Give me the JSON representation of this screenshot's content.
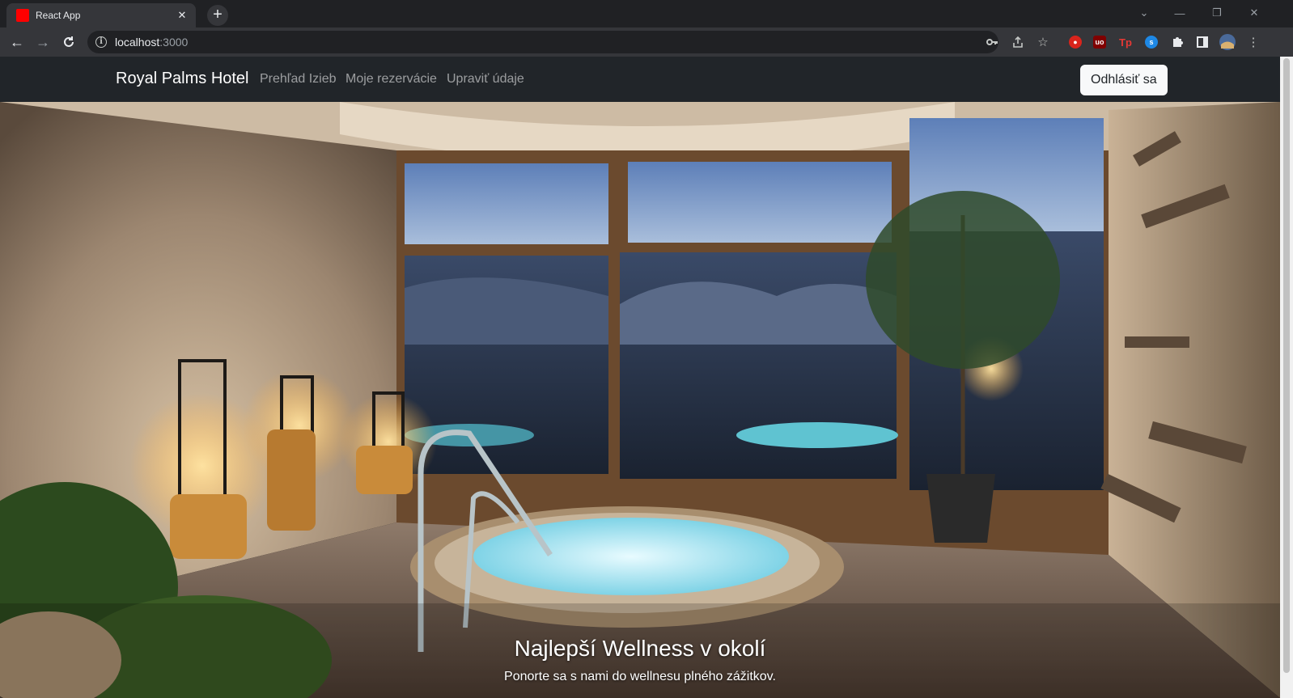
{
  "browser": {
    "tab_title": "React App",
    "tab_close": "✕",
    "new_tab": "+",
    "url_host": "localhost",
    "url_port": ":3000",
    "favicon_color": "#ff0000",
    "icons": [
      "back-icon",
      "forward-icon",
      "reload-icon",
      "info-icon",
      "key-icon",
      "share-icon",
      "star-icon",
      "puzzle-icon",
      "sidepanel-icon",
      "profile-icon",
      "menu-icon"
    ]
  },
  "navbar": {
    "brand": "Royal Palms Hotel",
    "links": [
      "Prehľad Izieb",
      "Moje rezervácie",
      "Upraviť údaje"
    ],
    "logout_label": "Odhlásiť sa",
    "background": "#212529"
  },
  "hero": {
    "title": "Najlepší Wellness v okolí",
    "subtitle": "Ponorte sa s nami do wellnesu plného zážitkov."
  }
}
